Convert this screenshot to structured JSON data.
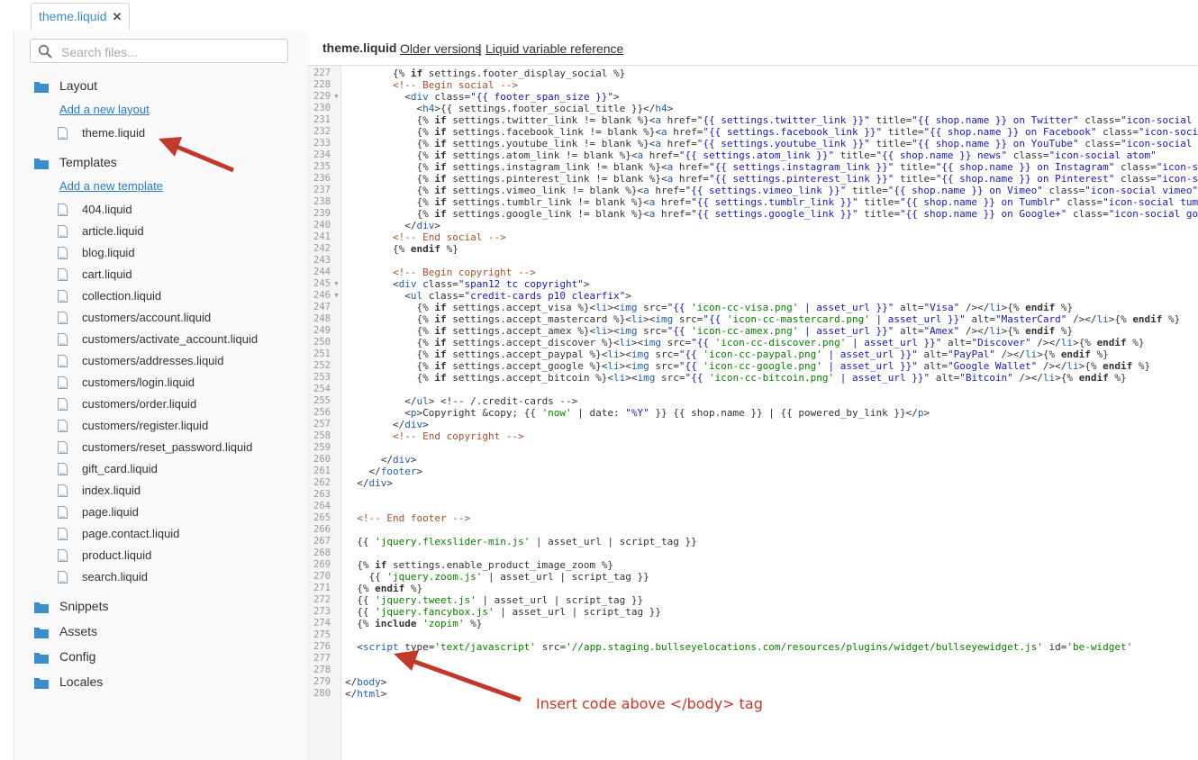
{
  "tab": {
    "title": "theme.liquid",
    "close": "✕"
  },
  "search": {
    "placeholder": "Search files..."
  },
  "sections": [
    {
      "label": "Layout",
      "add_link": "Add a new layout",
      "files": [
        "theme.liquid"
      ]
    },
    {
      "label": "Templates",
      "add_link": "Add a new template",
      "files": [
        "404.liquid",
        "article.liquid",
        "blog.liquid",
        "cart.liquid",
        "collection.liquid",
        "customers/account.liquid",
        "customers/activate_account.liquid",
        "customers/addresses.liquid",
        "customers/login.liquid",
        "customers/order.liquid",
        "customers/register.liquid",
        "customers/reset_password.liquid",
        "gift_card.liquid",
        "index.liquid",
        "page.liquid",
        "page.contact.liquid",
        "product.liquid",
        "search.liquid"
      ]
    },
    {
      "label": "Snippets"
    },
    {
      "label": "Assets"
    },
    {
      "label": "Config"
    },
    {
      "label": "Locales"
    }
  ],
  "header": {
    "title": "theme.liquid",
    "older_versions": "Older versions",
    "separator": "|",
    "reference": "Liquid variable reference"
  },
  "editor": {
    "fold_markers": [
      229,
      245,
      246
    ],
    "lines": [
      {
        "n": 227,
        "text": "        {% if settings.footer_display_social %}"
      },
      {
        "n": 228,
        "text": "        <!-- Begin social -->"
      },
      {
        "n": 229,
        "text": "          <div class=\"{{ footer_span_size }}\">"
      },
      {
        "n": 230,
        "text": "            <h4>{{ settings.footer_social_title }}</h4>"
      },
      {
        "n": 231,
        "text": "            {% if settings.twitter_link != blank %}<a href=\"{{ settings.twitter_link }}\" title=\"{{ shop.name }} on Twitter\" class=\"icon-social twitter\" target=\"_blank\">"
      },
      {
        "n": 232,
        "text": "            {% if settings.facebook_link != blank %}<a href=\"{{ settings.facebook_link }}\" title=\"{{ shop.name }} on Facebook\" class=\"icon-social facebook\""
      },
      {
        "n": 233,
        "text": "            {% if settings.youtube_link != blank %}<a href=\"{{ settings.youtube_link }}\" title=\"{{ shop.name }} on YouTube\" class=\"icon-social youtube\""
      },
      {
        "n": 234,
        "text": "            {% if settings.atom_link != blank %}<a href=\"{{ settings.atom_link }}\" title=\"{{ shop.name }} news\" class=\"icon-social atom\""
      },
      {
        "n": 235,
        "text": "            {% if settings.instagram_link != blank %}<a href=\"{{ settings.instagram_link }}\" title=\"{{ shop.name }} on Instagram\" class=\"icon-social\""
      },
      {
        "n": 236,
        "text": "            {% if settings.pinterest_link != blank %}<a href=\"{{ settings.pinterest_link }}\" title=\"{{ shop.name }} on Pinterest\" class=\"icon-social\""
      },
      {
        "n": 237,
        "text": "            {% if settings.vimeo_link != blank %}<a href=\"{{ settings.vimeo_link }}\" title=\"{{ shop.name }} on Vimeo\" class=\"icon-social vimeo\""
      },
      {
        "n": 238,
        "text": "            {% if settings.tumblr_link != blank %}<a href=\"{{ settings.tumblr_link }}\" title=\"{{ shop.name }} on Tumblr\" class=\"icon-social tumblr\""
      },
      {
        "n": 239,
        "text": "            {% if settings.google_link != blank %}<a href=\"{{ settings.google_link }}\" title=\"{{ shop.name }} on Google+\" class=\"icon-social google\""
      },
      {
        "n": 240,
        "text": "          </div>"
      },
      {
        "n": 241,
        "text": "        <!-- End social -->"
      },
      {
        "n": 242,
        "text": "        {% endif %}"
      },
      {
        "n": 243,
        "text": ""
      },
      {
        "n": 244,
        "text": "        <!-- Begin copyright -->"
      },
      {
        "n": 245,
        "text": "        <div class=\"span12 tc copyright\">"
      },
      {
        "n": 246,
        "text": "          <ul class=\"credit-cards p10 clearfix\">"
      },
      {
        "n": 247,
        "text": "            {% if settings.accept_visa %}<li><img src=\"{{ 'icon-cc-visa.png' | asset_url }}\" alt=\"Visa\" /></li>{% endif %}"
      },
      {
        "n": 248,
        "text": "            {% if settings.accept_mastercard %}<li><img src=\"{{ 'icon-cc-mastercard.png' | asset_url }}\" alt=\"MasterCard\" /></li>{% endif %}"
      },
      {
        "n": 249,
        "text": "            {% if settings.accept_amex %}<li><img src=\"{{ 'icon-cc-amex.png' | asset_url }}\" alt=\"Amex\" /></li>{% endif %}"
      },
      {
        "n": 250,
        "text": "            {% if settings.accept_discover %}<li><img src=\"{{ 'icon-cc-discover.png' | asset_url }}\" alt=\"Discover\" /></li>{% endif %}"
      },
      {
        "n": 251,
        "text": "            {% if settings.accept_paypal %}<li><img src=\"{{ 'icon-cc-paypal.png' | asset_url }}\" alt=\"PayPal\" /></li>{% endif %}"
      },
      {
        "n": 252,
        "text": "            {% if settings.accept_google %}<li><img src=\"{{ 'icon-cc-google.png' | asset_url }}\" alt=\"Google Wallet\" /></li>{% endif %}"
      },
      {
        "n": 253,
        "text": "            {% if settings.accept_bitcoin %}<li><img src=\"{{ 'icon-cc-bitcoin.png' | asset_url }}\" alt=\"Bitcoin\" /></li>{% endif %}"
      },
      {
        "n": 254,
        "text": ""
      },
      {
        "n": 255,
        "text": "          </ul> <!-- /.credit-cards -->"
      },
      {
        "n": 256,
        "text": "          <p>Copyright &copy; {{ 'now' | date: \"%Y\" }} {{ shop.name }} | {{ powered_by_link }}</p>"
      },
      {
        "n": 257,
        "text": "        </div>"
      },
      {
        "n": 258,
        "text": "        <!-- End copyright -->"
      },
      {
        "n": 259,
        "text": ""
      },
      {
        "n": 260,
        "text": "      </div>"
      },
      {
        "n": 261,
        "text": "    </footer>"
      },
      {
        "n": 262,
        "text": "  </div>"
      },
      {
        "n": 263,
        "text": ""
      },
      {
        "n": 264,
        "text": ""
      },
      {
        "n": 265,
        "text": "  <!-- End footer -->"
      },
      {
        "n": 266,
        "text": ""
      },
      {
        "n": 267,
        "text": "  {{ 'jquery.flexslider-min.js' | asset_url | script_tag }}"
      },
      {
        "n": 268,
        "text": ""
      },
      {
        "n": 269,
        "text": "  {% if settings.enable_product_image_zoom %}"
      },
      {
        "n": 270,
        "text": "    {{ 'jquery.zoom.js' | asset_url | script_tag }}"
      },
      {
        "n": 271,
        "text": "  {% endif %}"
      },
      {
        "n": 272,
        "text": "  {{ 'jquery.tweet.js' | asset_url | script_tag }}"
      },
      {
        "n": 273,
        "text": "  {{ 'jquery.fancybox.js' | asset_url | script_tag }}"
      },
      {
        "n": 274,
        "text": "  {% include 'zopim' %}"
      },
      {
        "n": 275,
        "text": ""
      },
      {
        "n": 276,
        "text": "  <script type='text/javascript' src='//app.staging.bullseyelocations.com/resources/plugins/widget/bullseyewidget.js' id='be-widget'"
      },
      {
        "n": 277,
        "text": ""
      },
      {
        "n": 278,
        "text": ""
      },
      {
        "n": 279,
        "text": "</body>"
      },
      {
        "n": 280,
        "text": "</html>"
      }
    ]
  },
  "annotation": "Insert code above </body> tag",
  "colors": {
    "arrow": "#c0392b",
    "link": "#2a7bc0",
    "folder": "#3a8dc9",
    "keyword": "#000000",
    "string": "#1a1aa6",
    "comment": "#aa5500"
  }
}
